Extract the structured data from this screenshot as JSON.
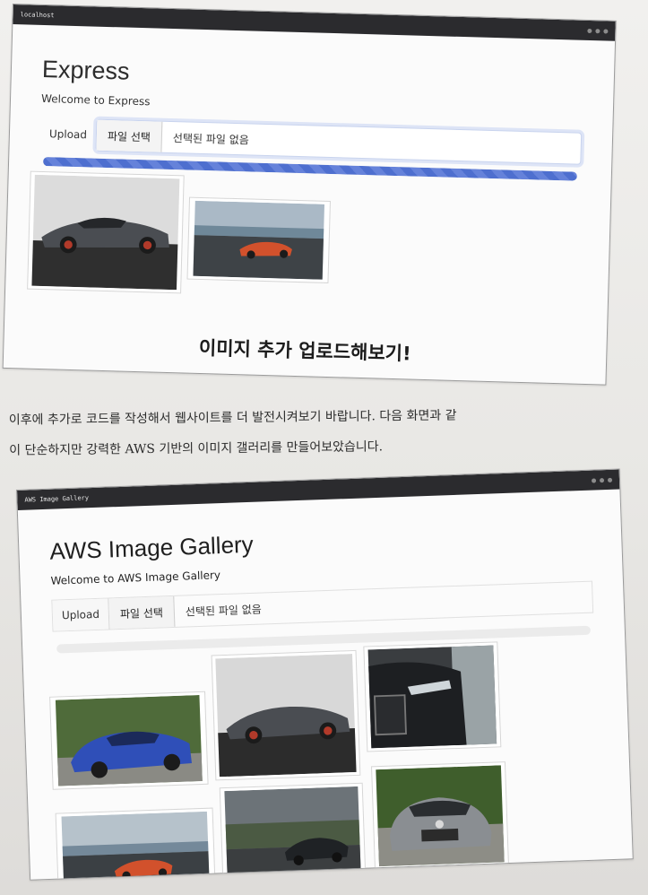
{
  "screenshot_1": {
    "browser_tab": "localhost",
    "app_title": "Express",
    "welcome": "Welcome to Express",
    "upload_label": "Upload",
    "file_button": "파일 선택",
    "file_status": "선택된 파일 없음",
    "progress": 1.0,
    "caption": "이미지 추가 업로드해보기!"
  },
  "body_text": {
    "line1": "이후에 추가로 코드를 작성해서 웹사이트를 더 발전시켜보기 바랍니다. 다음 화면과 같",
    "line2": "이 단순하지만 강력한 AWS 기반의 이미지 갤러리를 만들어보았습니다."
  },
  "screenshot_2": {
    "browser_tab": "AWS Image Gallery",
    "app_title": "AWS Image Gallery",
    "welcome": "Welcome to AWS Image Gallery",
    "upload_label": "Upload",
    "file_button": "파일 선택",
    "file_status": "선택된 파일 없음",
    "progress": 0.0
  },
  "colors": {
    "progress_blue": "#4e6fcf",
    "browser_bar": "#2b2b2e"
  }
}
